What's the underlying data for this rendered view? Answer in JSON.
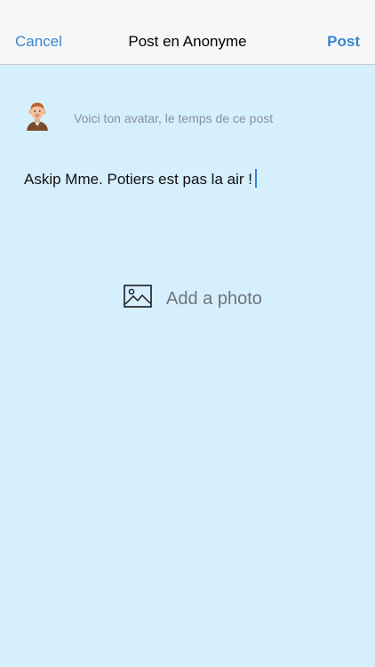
{
  "navbar": {
    "cancel_label": "Cancel",
    "title": "Post en Anonyme",
    "post_label": "Post"
  },
  "composer": {
    "avatar_caption": "Voici ton avatar, le temps de ce post",
    "text_value": "Askip Mme. Potiers est pas la air !",
    "add_photo_label": "Add a photo",
    "add_photo_icon": "image-icon",
    "avatar_icon": "man-face-avatar"
  },
  "colors": {
    "accent": "#3a87cf",
    "background": "#d5effd",
    "navbar_background": "#f7f7f8",
    "caret": "#3a7fd5"
  }
}
